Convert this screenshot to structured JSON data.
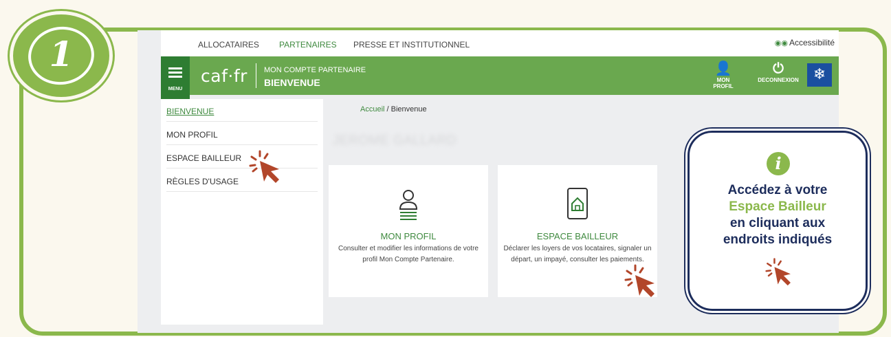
{
  "step": {
    "number": "1"
  },
  "topnav": {
    "items": [
      "ALLOCATAIRES",
      "PARTENAIRES",
      "PRESSE ET INSTITUTIONNEL"
    ],
    "active_index": 1,
    "accessibility": "Accessibilité"
  },
  "header": {
    "menu_label": "MENU",
    "logo": "caf·fr",
    "account_label": "MON COMPTE PARTENAIRE",
    "welcome": "BIENVENUE",
    "profile_button": "MON PROFIL",
    "logout_button": "DECONNEXION"
  },
  "sidebar": {
    "items": [
      "BIENVENUE",
      "MON PROFIL",
      "ESPACE BAILLEUR",
      "RÈGLES D'USAGE"
    ]
  },
  "breadcrumb": {
    "home": "Accueil",
    "separator": "/",
    "current": "Bienvenue"
  },
  "user_name_blurred": "JEROME GALLARD",
  "cards": [
    {
      "title": "MON PROFIL",
      "description": "Consulter et modifier les informations de votre profil Mon Compte Partenaire."
    },
    {
      "title": "ESPACE BAILLEUR",
      "description": "Déclarer les loyers de vos locataires, signaler un départ, un impayé, consulter les paiements."
    }
  ],
  "info_box": {
    "line1": "Accédez à votre",
    "line2": "Espace Bailleur",
    "line3": "en cliquant aux",
    "line4": "endroits indiqués"
  },
  "colors": {
    "accent_green": "#8bb84c",
    "caf_green": "#6aa84f",
    "dark_navy": "#1d2d5c",
    "cursor": "#b2462a"
  }
}
